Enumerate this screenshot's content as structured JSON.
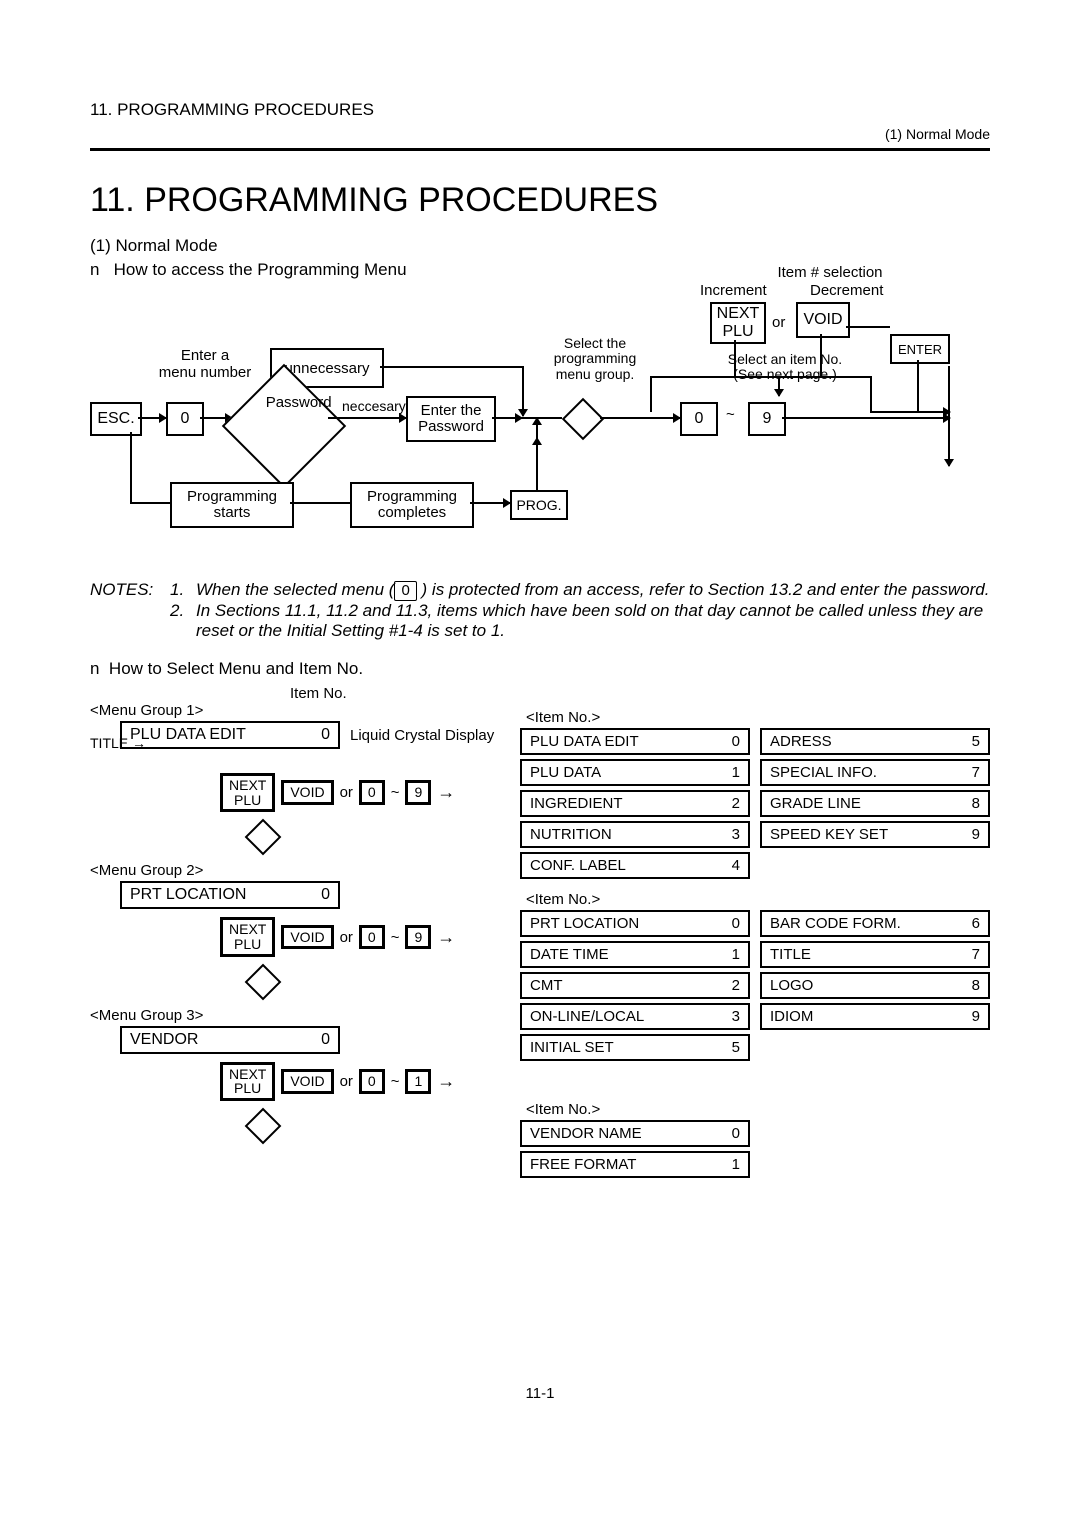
{
  "header": {
    "left": "11. PROGRAMMING PROCEDURES",
    "right": "(1) Normal Mode"
  },
  "title": "11. PROGRAMMING PROCEDURES",
  "subtitle1": "(1) Normal Mode",
  "subtitle2_prefix": "n",
  "subtitle2": "How to access the Programming Menu",
  "flow": {
    "item_sel": "Item # selection",
    "increment": "Increment",
    "decrement": "Decrement",
    "next_plu_top": "NEXT",
    "next_plu_bot": "PLU",
    "or": "or",
    "void": "VOID",
    "enter": "ENTER",
    "enter_a": "Enter a",
    "menu_number": "menu number",
    "unnecessary": "unnecessary",
    "select_the": "Select the",
    "programming": "programming",
    "menu_group": "menu group.",
    "select_item": "Select an item No.",
    "see_next": "(See next page.)",
    "esc": "ESC.",
    "zero": "0",
    "password": "Password",
    "neccesary": "neccesary",
    "enter_the": "Enter the",
    "password2": "Password",
    "tilde": "~",
    "nine": "9",
    "prog_starts": "Programming",
    "starts": "starts",
    "prog_completes": "Programming",
    "completes": "completes",
    "prog": "PROG."
  },
  "notes": {
    "lead": "NOTES:",
    "n1": "1.",
    "n1txt_a": "When the selected menu (",
    "n1key": "0",
    "n1txt_b": ") is protected from an access, refer to Section 13.2 and enter the password.",
    "n2": "2.",
    "n2txt": "In Sections 11.1, 11.2 and 11.3, items which have been sold on that day cannot be called unless they are reset or the Initial Setting #1-4 is set to 1."
  },
  "sec2_prefix": "n",
  "sec2": "How to Select Menu and Item No.",
  "lower": {
    "item_no_lbl": "Item No.",
    "lcd": "Liquid Crystal Display",
    "title_lbl": "TITLE",
    "groups": [
      {
        "label": "<Menu Group 1>",
        "disp_name": "PLU DATA EDIT",
        "disp_num": "0",
        "range_hi": "9"
      },
      {
        "label": "<Menu Group 2>",
        "disp_name": "PRT LOCATION",
        "disp_num": "0",
        "range_hi": "9"
      },
      {
        "label": "<Menu Group 3>",
        "disp_name": "VENDOR",
        "disp_num": "0",
        "range_hi": "1"
      }
    ],
    "key_next_top": "NEXT",
    "key_next_bot": "PLU",
    "key_void": "VOID",
    "or": "or",
    "zero": "0",
    "tilde": "~",
    "item_hdr": "<Item No.>",
    "items1": [
      {
        "l": {
          "n": "PLU DATA EDIT",
          "v": "0"
        },
        "r": {
          "n": "ADRESS",
          "v": "5"
        }
      },
      {
        "l": {
          "n": "PLU DATA",
          "v": "1"
        },
        "r": {
          "n": "SPECIAL INFO.",
          "v": "7"
        }
      },
      {
        "l": {
          "n": "INGREDIENT",
          "v": "2"
        },
        "r": {
          "n": "GRADE LINE",
          "v": "8"
        }
      },
      {
        "l": {
          "n": "NUTRITION",
          "v": "3"
        },
        "r": {
          "n": "SPEED KEY SET",
          "v": "9"
        }
      },
      {
        "l": {
          "n": "CONF. LABEL",
          "v": "4"
        }
      }
    ],
    "items2": [
      {
        "l": {
          "n": "PRT LOCATION",
          "v": "0"
        },
        "r": {
          "n": "BAR CODE FORM.",
          "v": "6"
        }
      },
      {
        "l": {
          "n": "DATE TIME",
          "v": "1"
        },
        "r": {
          "n": "TITLE",
          "v": "7"
        }
      },
      {
        "l": {
          "n": "CMT",
          "v": "2"
        },
        "r": {
          "n": "LOGO",
          "v": "8"
        }
      },
      {
        "l": {
          "n": "ON-LINE/LOCAL",
          "v": "3"
        },
        "r": {
          "n": "IDIOM",
          "v": "9"
        }
      },
      {
        "l": {
          "n": "INITIAL SET",
          "v": "5"
        }
      }
    ],
    "items3": [
      {
        "l": {
          "n": "VENDOR NAME",
          "v": "0"
        }
      },
      {
        "l": {
          "n": "FREE FORMAT",
          "v": "1"
        }
      }
    ]
  },
  "footer": "11-1"
}
